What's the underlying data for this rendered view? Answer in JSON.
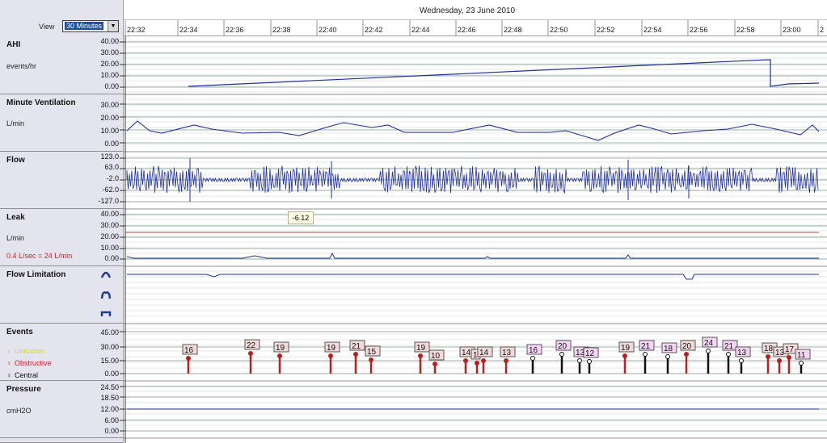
{
  "view": {
    "label": "View",
    "selected": "30 Minutes"
  },
  "date": "Wednesday, 23 June 2010",
  "time_ticks": [
    "22:32",
    "22:34",
    "22:36",
    "22:38",
    "22:40",
    "22:42",
    "22:44",
    "22:46",
    "22:48",
    "22:50",
    "22:52",
    "22:54",
    "22:56",
    "22:58",
    "23:00",
    "2"
  ],
  "panels": {
    "ahi": {
      "title": "AHI",
      "unit": "events/hr",
      "ticks": [
        "40.00",
        "30.00",
        "20.00",
        "10.00",
        "0.00"
      ]
    },
    "mv": {
      "title": "Minute Ventilation",
      "unit": "L/min",
      "ticks": [
        "30.00",
        "20.00",
        "10.00",
        "0.00"
      ]
    },
    "flow": {
      "title": "Flow",
      "ticks": [
        "123.0",
        "63.0",
        "-2.0",
        "-62.0",
        "-127.0"
      ]
    },
    "leak": {
      "title": "Leak",
      "unit": "L/min",
      "note": "0.4 L/sec = 24 L/min",
      "ticks": [
        "40.00",
        "30.00",
        "20.00",
        "10.00",
        "0.00"
      ]
    },
    "fl": {
      "title": "Flow Limitation"
    },
    "events": {
      "title": "Events",
      "ticks": [
        "45.00",
        "30.00",
        "15.00",
        "0.00"
      ],
      "legend": [
        {
          "label": "Unknown",
          "color": "#d8d838"
        },
        {
          "label": "Obstructive",
          "color": "#d02020"
        },
        {
          "label": "Central",
          "color": "#111111"
        }
      ],
      "markers": [
        {
          "v": "16",
          "t": "o"
        },
        {
          "v": "22",
          "t": "o"
        },
        {
          "v": "19",
          "t": "o"
        },
        {
          "v": "19",
          "t": "o"
        },
        {
          "v": "21",
          "t": "o"
        },
        {
          "v": "15",
          "t": "o"
        },
        {
          "v": "19",
          "t": "o"
        },
        {
          "v": "10",
          "t": "o"
        },
        {
          "v": "14",
          "t": "o"
        },
        {
          "v": "1",
          "t": "o"
        },
        {
          "v": "14",
          "t": "o"
        },
        {
          "v": "13",
          "t": "o"
        },
        {
          "v": "16",
          "t": "c"
        },
        {
          "v": "20",
          "t": "c"
        },
        {
          "v": "13",
          "t": "c"
        },
        {
          "v": "12",
          "t": "c"
        },
        {
          "v": "19",
          "t": "o"
        },
        {
          "v": "21",
          "t": "c"
        },
        {
          "v": "18",
          "t": "c"
        },
        {
          "v": "20",
          "t": "o"
        },
        {
          "v": "24",
          "t": "c"
        },
        {
          "v": "21",
          "t": "c"
        },
        {
          "v": "13",
          "t": "c"
        },
        {
          "v": "18",
          "t": "o"
        },
        {
          "v": "13",
          "t": "o"
        },
        {
          "v": "17",
          "t": "o"
        },
        {
          "v": "11",
          "t": "c"
        }
      ]
    },
    "pressure": {
      "title": "Pressure",
      "unit": "cmH2O",
      "ticks": [
        "24.50",
        "18.50",
        "12.00",
        "6.00",
        "0.00"
      ]
    }
  },
  "tooltip": "-6.12",
  "colors": {
    "trace": "#2030a0",
    "leak_threshold": "#c04040",
    "grid": "#7a9a8a",
    "label_bg": "#e4e4ee"
  }
}
